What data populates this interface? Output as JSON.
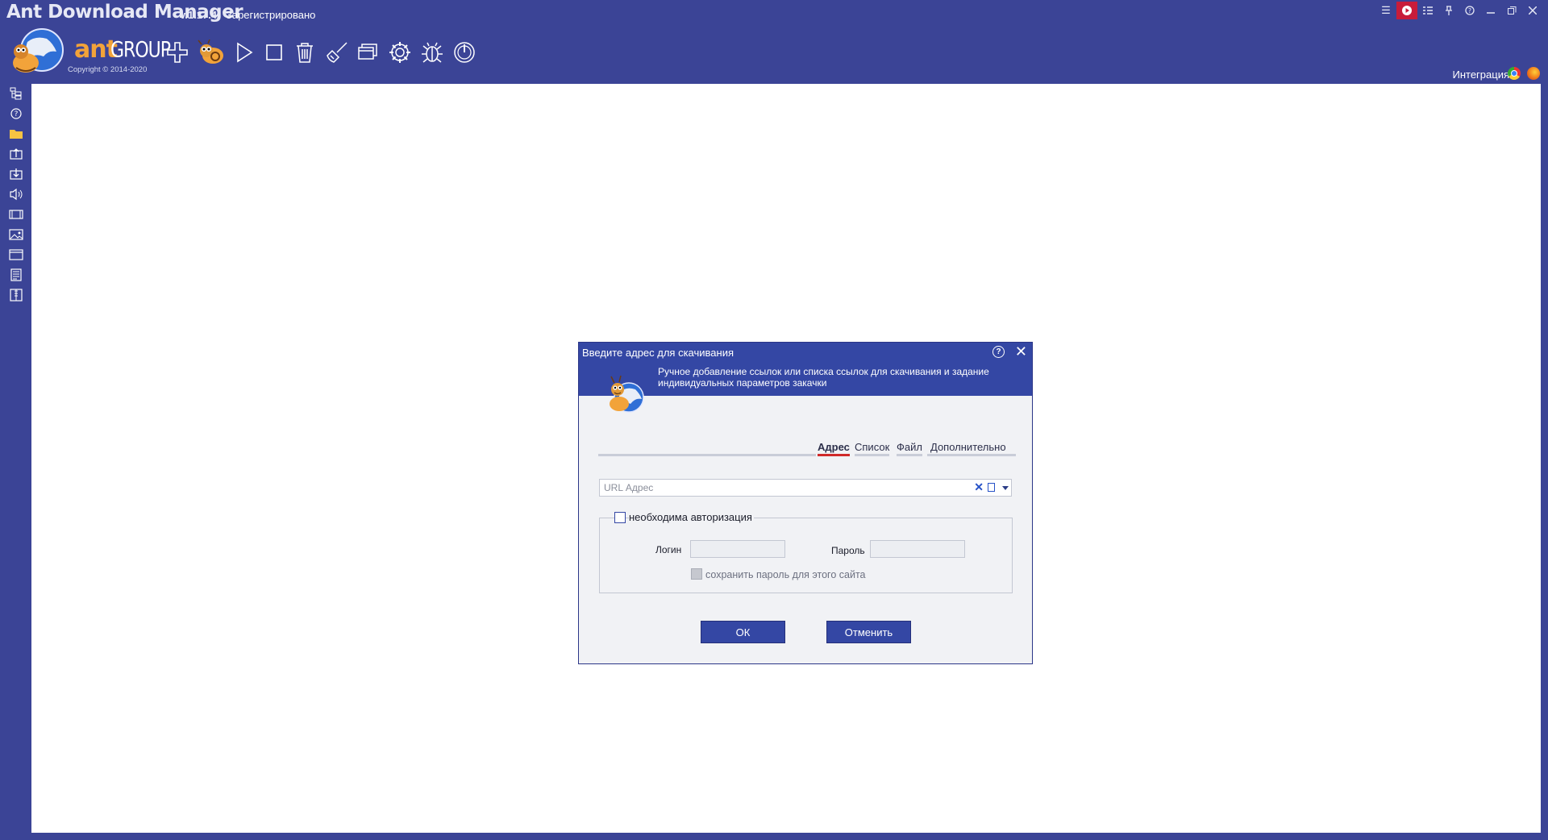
{
  "titlebar": {
    "app_name": "Ant Download Manager",
    "version": "v.1.17.4",
    "registration": "Зарегистрировано",
    "controls": [
      "menu-icon",
      "record-icon",
      "list-icon",
      "pin-icon",
      "help-icon",
      "minimize-icon",
      "restore-icon",
      "close-icon"
    ]
  },
  "brand": {
    "word1": "ant",
    "word2": "GROUP",
    "copyright": "Copyright © 2014-2020"
  },
  "toolbar": {
    "tools": [
      "add-icon",
      "ant-icon",
      "play-icon",
      "stop-icon",
      "trash-icon",
      "broom-icon",
      "windows-icon",
      "settings-icon",
      "bug-icon",
      "power-icon"
    ]
  },
  "integration": {
    "label": "Интеграция",
    "browsers": [
      "chrome-icon",
      "firefox-icon"
    ]
  },
  "sidebar": {
    "icons": [
      "tree-icon",
      "help-icon",
      "folder-icon",
      "upload-icon",
      "download-icon",
      "audio-icon",
      "video-icon",
      "image-icon",
      "window-icon",
      "document-icon",
      "archive-icon"
    ]
  },
  "colors": {
    "frame": "#3b4496",
    "dialog_header": "#3447a4",
    "accent_red": "#d02a2a",
    "brand_orange": "#f2a33a"
  },
  "dialog": {
    "title": "Введите адрес для скачивания",
    "description": "Ручное добавление ссылок или списка ссылок для скачивания и задание индивидуальных параметров закачки",
    "tabs": [
      {
        "label": "Адрес",
        "active": true
      },
      {
        "label": "Список",
        "active": false
      },
      {
        "label": "Файл",
        "active": false
      },
      {
        "label": "Дополнительно",
        "active": false
      }
    ],
    "url": {
      "value": "",
      "placeholder": "URL Адрес"
    },
    "auth": {
      "label": "необходима авторизация",
      "checked": false,
      "login_label": "Логин",
      "login_value": "",
      "password_label": "Пароль",
      "password_value": "",
      "save_label": "сохранить пароль для этого сайта",
      "save_checked": false
    },
    "ok_label": "ОК",
    "cancel_label": "Отменить"
  }
}
